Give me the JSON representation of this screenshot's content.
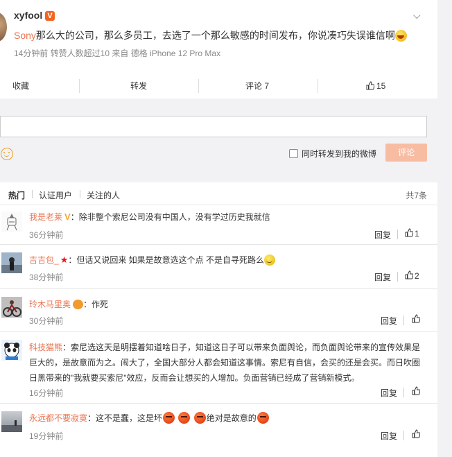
{
  "post": {
    "author": "xyfool",
    "verified_badge": "V",
    "content_highlight": "Sony",
    "content_rest": "那么大的公司，那么多员工，去选了一个那么敏感的时间发布，你说凑巧失误谁信啊",
    "meta": "14分钟前 转赞人数超过10 来自 德格 iPhone 12 Pro Max"
  },
  "actions": {
    "favorite": "收藏",
    "repost": "转发",
    "comment": "评论 7",
    "like_count": "15"
  },
  "reply_box": {
    "forward_label": "同时转发到我的微博",
    "submit": "评论"
  },
  "tabs": {
    "hot": "热门",
    "verified": "认证用户",
    "following": "关注的人",
    "total": "共7条"
  },
  "comments": [
    {
      "user": "我是老莱",
      "text": "：除非整个索尼公司没有中国人，没有学过历史我就信",
      "time": "36分钟前",
      "reply": "回复",
      "likes": "1"
    },
    {
      "user": "吉吉包_",
      "text": "：但话又说回来 如果是故意选这个点 不是自寻死路么",
      "time": "38分钟前",
      "reply": "回复",
      "likes": "2"
    },
    {
      "user": "玲木马里奥",
      "text": "：作死",
      "time": "30分钟前",
      "reply": "回复",
      "likes": ""
    },
    {
      "user": "科技猫熊",
      "text": "：索尼选这天是明摆着知道啥日子，知道这日子可以带来负面舆论，而负面舆论带来的宣传效果是巨大的，是故意而为之。闹大了，全国大部分人都会知道这事情。索尼有自信，会买的还是会买。而日吹圈日黑带来的\"我就要买索尼\"效应，反而会让想买的人增加。负面营销已经成了营销新模式。",
      "time": "16分钟前",
      "reply": "回复",
      "likes": ""
    },
    {
      "user": "永远都不要寂寞",
      "text_a": "：这不是蠢，这是坏",
      "text_b": "绝对是故意的",
      "time": "19分钟前",
      "reply": "回复",
      "likes": ""
    }
  ]
}
